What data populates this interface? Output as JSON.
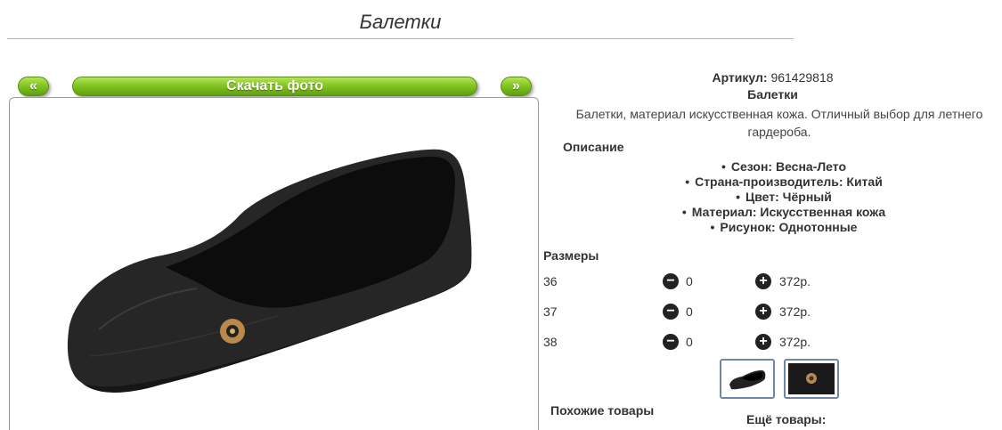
{
  "page": {
    "title": "Балетки"
  },
  "gallery": {
    "prev_label": "«",
    "next_label": "»",
    "download_label": "Скачать фото"
  },
  "product": {
    "article_label": "Артикул:",
    "article_value": "961429818",
    "name": "Балетки",
    "description": "Балетки, материал искусственная кожа. Отличный выбор для летнего гардероба.",
    "description_heading": "Описание",
    "properties": [
      "Сезон: Весна-Лето",
      "Страна-производитель: Китай",
      "Цвет: Чёрный",
      "Материал: Искусственная кожа",
      "Рисунок: Однотонные"
    ]
  },
  "sizes": {
    "heading": "Размеры",
    "rows": [
      {
        "size": "36",
        "qty": "0",
        "price": "372р."
      },
      {
        "size": "37",
        "qty": "0",
        "price": "372р."
      },
      {
        "size": "38",
        "qty": "0",
        "price": "372р."
      }
    ]
  },
  "bottom": {
    "similar_label": "Похожие товары",
    "more_label": "Ещё товары:"
  },
  "colors": {
    "accent_green": "#84c623",
    "thumb_border": "#6c87a8"
  },
  "icons": {
    "minus": "minus-circle-icon",
    "plus": "plus-circle-icon"
  }
}
